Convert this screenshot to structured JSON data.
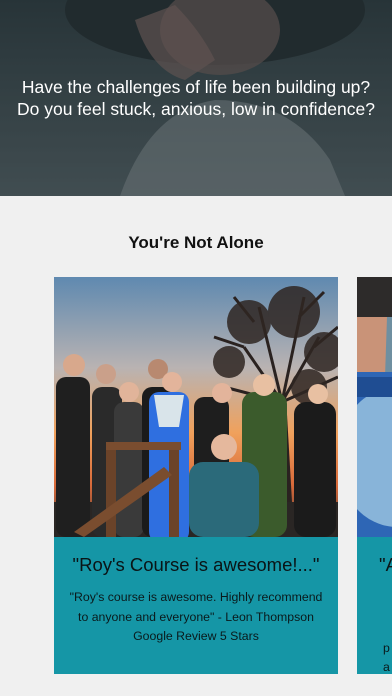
{
  "hero": {
    "line1": "Have the challenges of life been building up?",
    "line2": "Do you feel stuck, anxious, low in confidence?"
  },
  "section": {
    "title": "You're Not Alone"
  },
  "testimonials": [
    {
      "title": "\"Roy's Course is awesome!...\"",
      "quote": "\"Roy's course is awesome. Highly recommend to anyone and everyone\" - Leon Thompson Google Review 5 Stars"
    },
    {
      "title_partial": "\"A",
      "line_partial_1": "p",
      "line_partial_2": "a"
    }
  ],
  "colors": {
    "card_body": "#1596a6",
    "background": "#f0f0f0"
  }
}
